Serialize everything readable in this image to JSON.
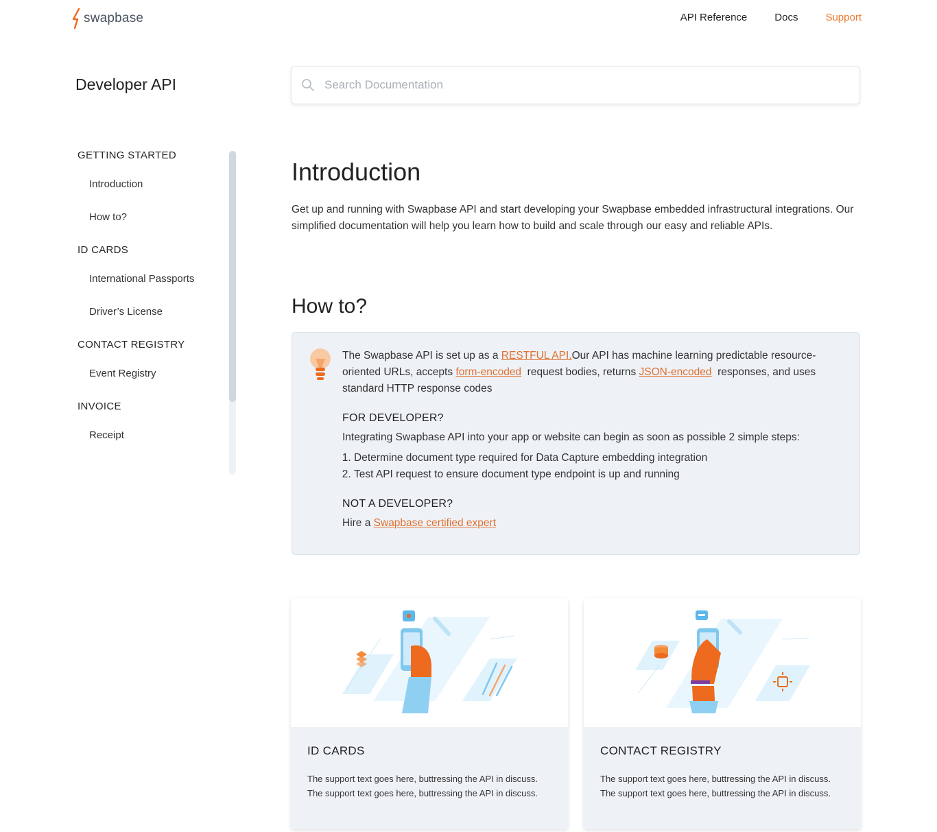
{
  "brand": {
    "logo_text": "swapbase",
    "accent": "#ed7a2e"
  },
  "topnav": {
    "items": [
      {
        "label": "API Reference"
      },
      {
        "label": "Docs"
      },
      {
        "label": "Support"
      }
    ]
  },
  "sidebar": {
    "title": "Developer API",
    "sections": [
      {
        "heading": "GETTING STARTED",
        "items": [
          "Introduction",
          "How to?"
        ]
      },
      {
        "heading": "ID CARDS",
        "items": [
          "International Passports",
          "Driver’s License"
        ]
      },
      {
        "heading": "CONTACT REGISTRY",
        "items": [
          "Event Registry"
        ]
      },
      {
        "heading": "INVOICE",
        "items": [
          "Receipt"
        ]
      }
    ]
  },
  "search": {
    "placeholder": "Search Documentation",
    "value": ""
  },
  "intro": {
    "title": "Introduction",
    "text": "Get up and running with Swapbase API and start developing your Swapbase embedded infrastructural integrations. Our simplified documentation will help you learn how to build and scale through our easy and reliable APIs."
  },
  "howto": {
    "title": "How to?",
    "p1_before": "The Swapbase API is set up as a ",
    "link_restful": "RESTFUL API.",
    "p1_mid1": "Our API has machine learning predictable resource-oriented URLs, accepts ",
    "link_form": "form-encoded",
    "p1_mid2": "  request bodies, returns ",
    "link_json": "JSON-encoded",
    "p1_after": "  responses, and uses standard HTTP response codes",
    "dev_heading": "FOR DEVELOPER?",
    "dev_text": "Integrating Swapbase API into your app or website can begin as soon as possible 2 simple steps:",
    "steps": [
      "Determine document type required for Data Capture embedding integration",
      "Test API request to ensure document type endpoint is up and running"
    ],
    "nondev_heading": "NOT A DEVELOPER?",
    "nondev_before": "Hire a ",
    "link_expert": "Swapbase certified expert"
  },
  "cards": [
    {
      "title": "ID CARDS",
      "text": "The support text goes here, buttressing the API in discuss. The support text goes here, buttressing the API in discuss."
    },
    {
      "title": "CONTACT REGISTRY",
      "text": "The support text goes here, buttressing the API in discuss. The support text goes here, buttressing the API in discuss."
    }
  ]
}
